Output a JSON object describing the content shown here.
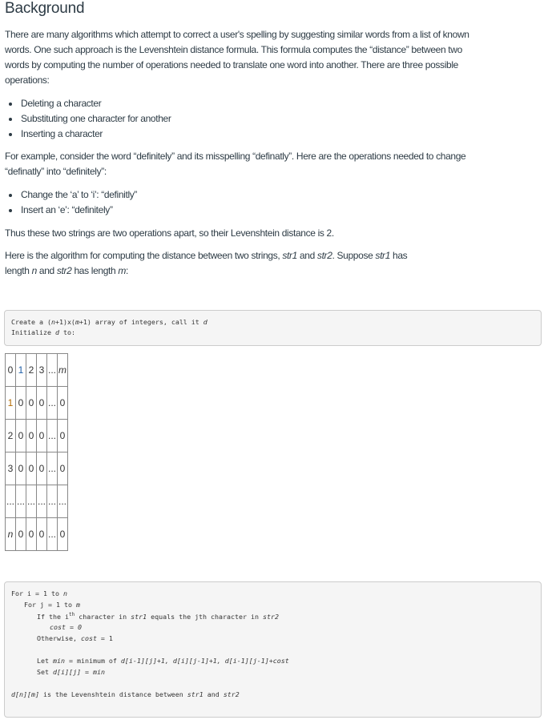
{
  "title": "Background",
  "intro": [
    "There are many algorithms which attempt to correct a user's spelling by suggesting similar words from a list of known",
    "words. One such approach is the Levenshtein distance formula.  This formula computes the “distance” between two",
    "words by computing the number of operations needed to translate one word into another.  There are three possible",
    "operations:"
  ],
  "operations": [
    "Deleting a character",
    "Substituting one character for another",
    "Inserting a character"
  ],
  "example": [
    "For example, consider the word “definitely” and its misspelling “definatly”.  Here are the operations needed to change",
    "“definatly” into “definitely”:"
  ],
  "steps": [
    "Change the ‘a’ to ‘i’: “definitly”",
    "Insert an ‘e’: “definitely”"
  ],
  "conclusion": "Thus these two strings are two operations apart, so their Levenshtein distance is 2.",
  "algo_intro": {
    "a": "Here is the algorithm for computing the distance between two strings, ",
    "str1": "str1",
    "b": " and ",
    "str2": "str2",
    "c": ".  Suppose ",
    "d": " has",
    "e": "length ",
    "n": "n",
    "f": " and ",
    "g": " has length ",
    "m": "m",
    "h": ":"
  },
  "code1": {
    "l1a": "Create a (",
    "n": "n",
    "l1b": "+1)x(",
    "m": "m",
    "l1c": "+1) array of integers, call it ",
    "d": "d",
    "l2a": "Initialize ",
    "l2b": " to:"
  },
  "table": [
    [
      "0",
      "1",
      "2",
      "3",
      "...",
      "m"
    ],
    [
      "1",
      "0",
      "0",
      "0",
      "...",
      "0"
    ],
    [
      "2",
      "0",
      "0",
      "0",
      "...",
      "0"
    ],
    [
      "3",
      "0",
      "0",
      "0",
      "...",
      "0"
    ],
    [
      "...",
      "...",
      "...",
      "...",
      "...",
      "..."
    ],
    [
      "n",
      "0",
      "0",
      "0",
      "...",
      "0"
    ]
  ],
  "code2": {
    "for_i": "For i = 1 to ",
    "n": "n",
    "for_j": "For j = 1 to ",
    "m": "m",
    "if_a": "If the i",
    "th": "th",
    "if_b": " character in ",
    "str1": "str1",
    "if_c": " equals the jth character in ",
    "str2": "str2",
    "cost0": "cost = 0",
    "other": "Otherwise, ",
    "cost1": "cost",
    "eq1": " = 1",
    "let_a": "Let ",
    "min": "min",
    "let_b": " = minimum of ",
    "expr": "d[i-1][j]+1, d[i][j-1]+1, d[i-1][j-1]+cost",
    "set_a": "Set ",
    "dij": "d[i][j]",
    "set_b": " = ",
    "dnm": "d[n][m]",
    "res": " is the Levenshtein distance between ",
    "and": " and "
  }
}
